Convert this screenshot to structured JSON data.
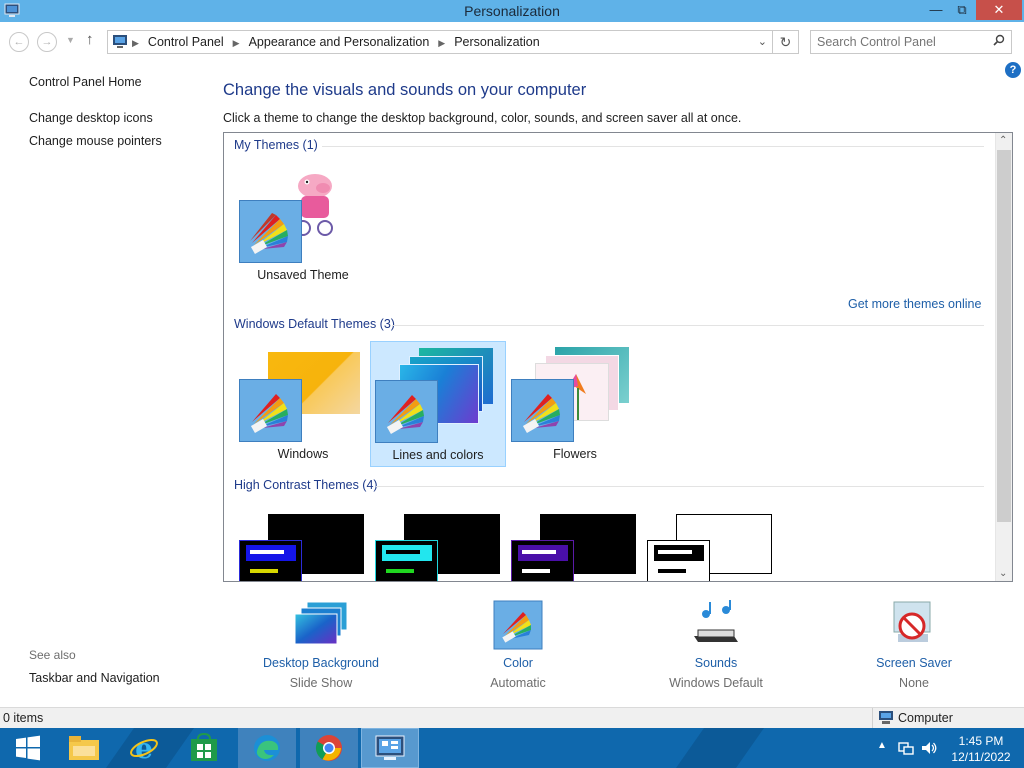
{
  "window": {
    "title": "Personalization"
  },
  "address": {
    "crumbs": [
      "Control Panel",
      "Appearance and Personalization",
      "Personalization"
    ],
    "search_placeholder": "Search Control Panel"
  },
  "left_pane": {
    "home": "Control Panel Home",
    "links": [
      "Change desktop icons",
      "Change mouse pointers"
    ],
    "see_also_label": "See also",
    "see_also_links": [
      "Taskbar and Navigation"
    ]
  },
  "main": {
    "heading": "Change the visuals and sounds on your computer",
    "description": "Click a theme to change the desktop background, color, sounds, and screen saver all at once.",
    "get_more_link": "Get more themes online",
    "groups": [
      {
        "title": "My Themes (1)",
        "themes": [
          {
            "name": "Unsaved Theme",
            "selected": false
          }
        ]
      },
      {
        "title": "Windows Default Themes (3)",
        "themes": [
          {
            "name": "Windows",
            "selected": false
          },
          {
            "name": "Lines and colors",
            "selected": true
          },
          {
            "name": "Flowers",
            "selected": false
          }
        ]
      },
      {
        "title": "High Contrast Themes (4)",
        "themes": []
      }
    ]
  },
  "settings": [
    {
      "name": "Desktop Background",
      "value": "Slide Show",
      "icon": "desktop-background-icon"
    },
    {
      "name": "Color",
      "value": "Automatic",
      "icon": "color-icon"
    },
    {
      "name": "Sounds",
      "value": "Windows Default",
      "icon": "sounds-icon"
    },
    {
      "name": "Screen Saver",
      "value": "None",
      "icon": "screen-saver-icon"
    }
  ],
  "status": {
    "items": "0 items",
    "location": "Computer"
  },
  "taskbar": {
    "time": "1:45 PM",
    "date": "12/11/2022",
    "apps": [
      "start-icon",
      "file-explorer-icon",
      "internet-explorer-icon",
      "store-icon",
      "edge-icon",
      "chrome-icon",
      "control-panel-icon"
    ]
  },
  "colors": {
    "titlebar": "#5fb2e8",
    "taskbar": "#0f68ad",
    "link": "#1e5fa8",
    "heading": "#1e3a8a",
    "selection": "#cce8ff"
  }
}
